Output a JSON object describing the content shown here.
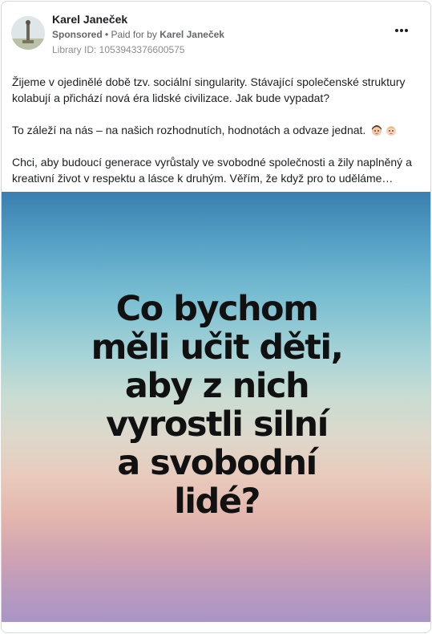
{
  "post": {
    "author": "Karel Janeček",
    "sponsored": "Sponsored",
    "separator": " • ",
    "paid_for_prefix": "Paid for by ",
    "paid_for_name": "Karel Janeček",
    "library_id": "Library ID: 1053943376600575",
    "more_icon": "more-horizontal-icon",
    "paragraphs": [
      "Žijeme v ojedinělé době tzv. sociální singularity. Stávající společenské struktury kolabují a přichází nová éra lidské civilizace. Jak bude vypadat?",
      "To záleží na nás – na našich rozhodnutích, hodnotách a odvaze jednat.",
      "Chci, aby budoucí generace vyrůstaly ve svobodné společnosti a žily naplněný a kreativní život v respektu a lásce k druhým. Věřím, že když pro to uděláme…"
    ],
    "emojis": [
      "girl-emoji",
      "baby-emoji"
    ]
  },
  "media": {
    "headline_lines": [
      "Co bychom",
      "měli učit děti,",
      "aby z nich",
      "vyrostli silní",
      "a svobodní",
      "lidé?"
    ]
  }
}
